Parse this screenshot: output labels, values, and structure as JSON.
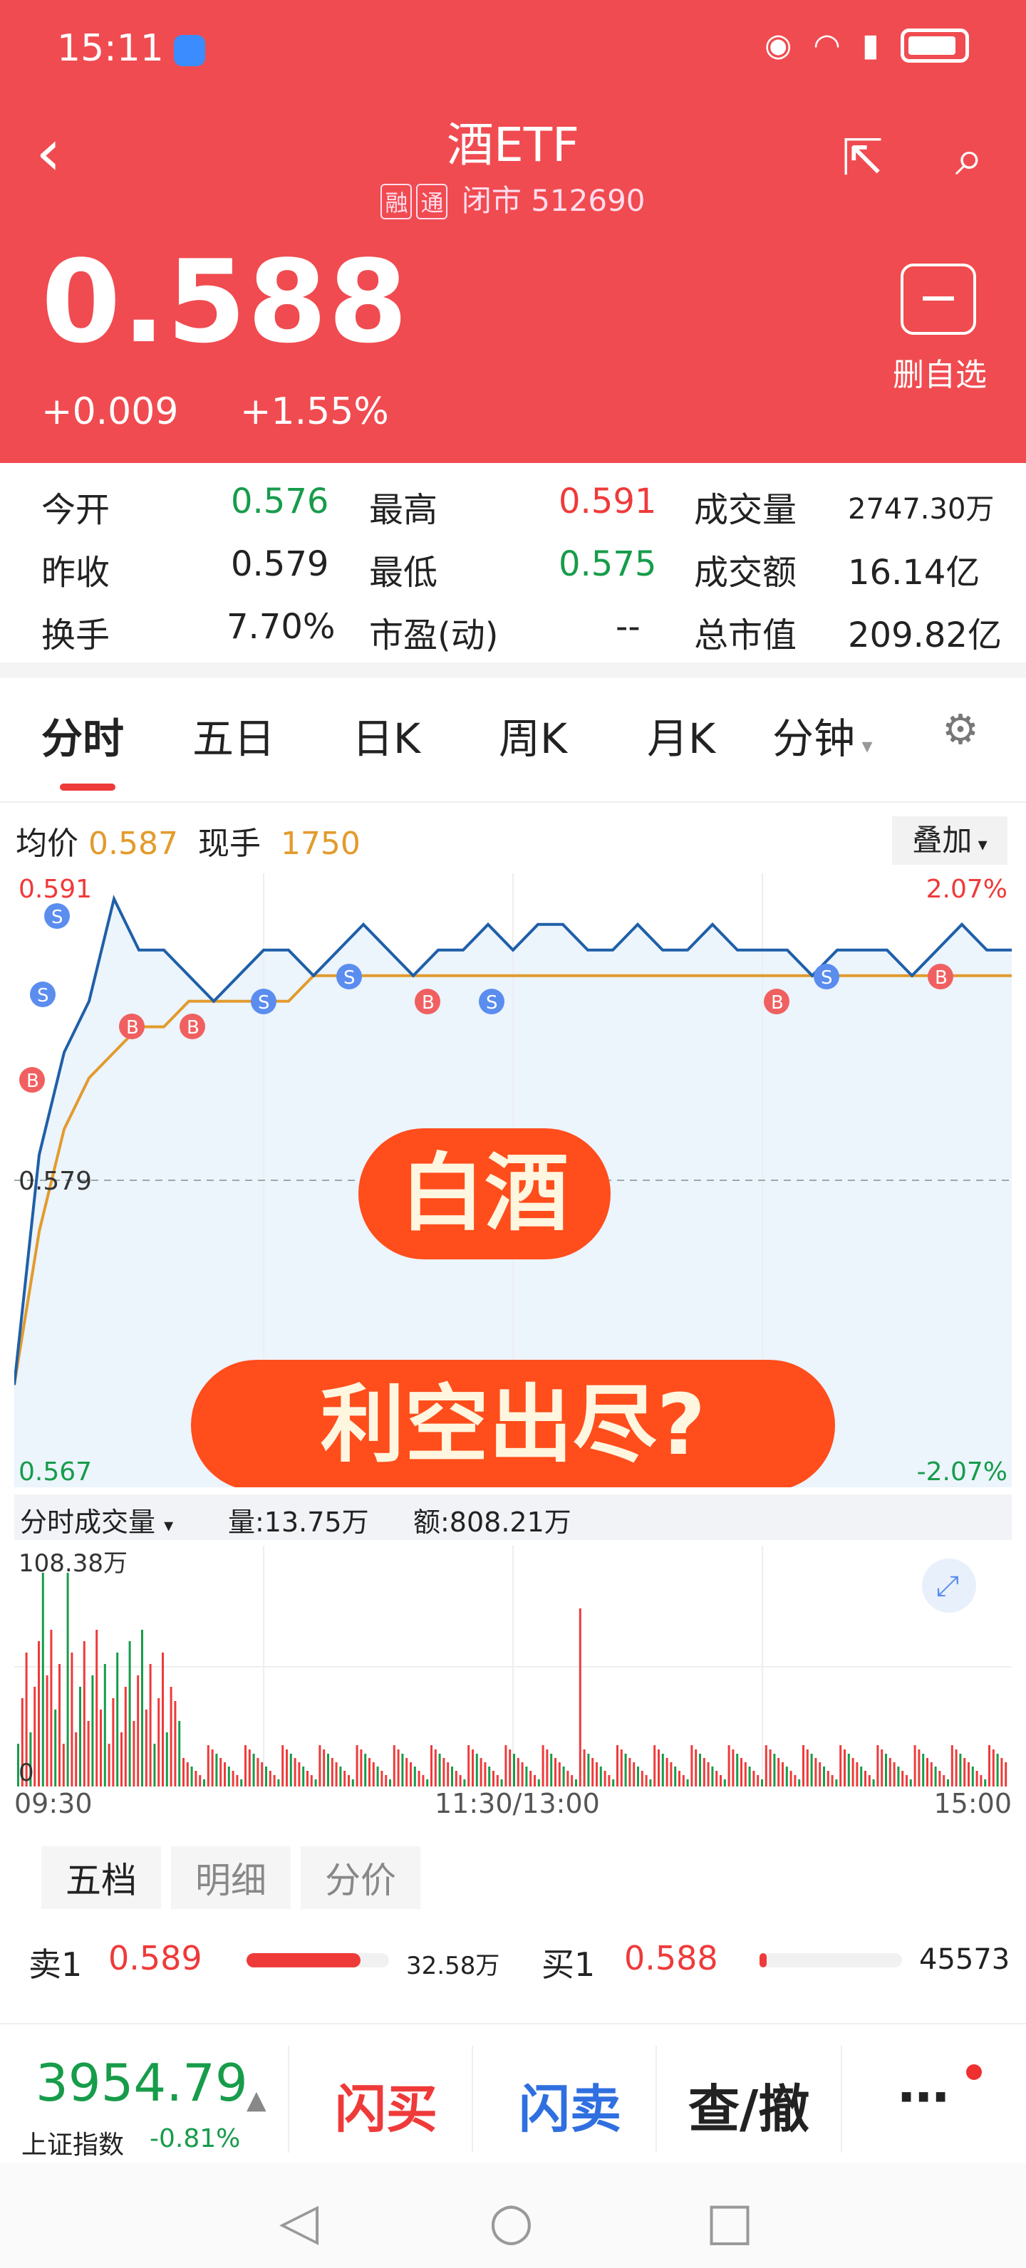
{
  "status_bar": {
    "time": "15:11"
  },
  "header": {
    "title": "酒ETF",
    "tag_rong": "融",
    "tag_tong": "通",
    "subtitle": "闭市 512690",
    "price": "0.588",
    "change": "+0.009",
    "change_pct": "+1.55%",
    "delete_label": "删自选"
  },
  "stats": [
    [
      {
        "label": "今开",
        "value": "0.576"
      },
      {
        "label": "最高",
        "value": "0.591"
      },
      {
        "label": "成交量",
        "value": "2747.30万"
      }
    ],
    [
      {
        "label": "昨收",
        "value": "0.579"
      },
      {
        "label": "最低",
        "value": "0.575"
      },
      {
        "label": "成交额",
        "value": "16.14亿"
      }
    ],
    [
      {
        "label": "换手",
        "value": "7.70%"
      },
      {
        "label": "市盈(动)",
        "value": "--"
      },
      {
        "label": "总市值",
        "value": "209.82亿"
      }
    ]
  ],
  "tabs": [
    "分时",
    "五日",
    "日K",
    "周K",
    "月K",
    "分钟"
  ],
  "chart_info": {
    "avg_label": "均价",
    "avg_value": "0.587",
    "now_label": "现手",
    "now_value": "1750",
    "overlay": "叠加"
  },
  "chart_labels": {
    "high": "0.591",
    "mid": "0.579",
    "low": "0.567",
    "pct_high": "2.07%",
    "pct_low": "-2.07%"
  },
  "overlay_text": {
    "line1": "白酒",
    "line2": "利空出尽?"
  },
  "volume_info": {
    "label": "分时成交量",
    "vol": "量:13.75万",
    "amt": "额:808.21万",
    "max": "108.38万",
    "zero": "0"
  },
  "time_axis": {
    "start": "09:30",
    "mid": "11:30/13:00",
    "end": "15:00"
  },
  "orderbook": {
    "tabs": [
      "五档",
      "明细",
      "分价"
    ],
    "sell1": {
      "label": "卖1",
      "price": "0.589",
      "vol": "32.58万"
    },
    "buy1": {
      "label": "买1",
      "price": "0.588",
      "vol": "45573"
    }
  },
  "bottom": {
    "index_value": "3954.79",
    "index_name": "上证指数",
    "index_pct": "-0.81%",
    "btn_buy": "闪买",
    "btn_sell": "闪卖",
    "btn_query": "查/撤"
  },
  "chart_data": {
    "type": "line",
    "ylim": [
      0.567,
      0.591
    ],
    "series": [
      {
        "values": [
          0.571,
          0.58,
          0.584,
          0.586,
          0.59,
          0.588,
          0.588,
          0.587,
          0.586,
          0.587,
          0.588,
          0.588,
          0.587,
          0.588,
          0.589,
          0.588,
          0.587,
          0.588,
          0.588,
          0.589,
          0.588,
          0.589,
          0.589,
          0.588,
          0.588,
          0.589,
          0.588,
          0.588,
          0.589,
          0.588,
          0.588,
          0.588,
          0.587,
          0.588,
          0.588,
          0.588,
          0.587,
          0.588,
          0.589,
          0.588,
          0.588
        ]
      },
      {
        "values": [
          0.571,
          0.577,
          0.581,
          0.583,
          0.584,
          0.585,
          0.585,
          0.586,
          0.586,
          0.586,
          0.586,
          0.586,
          0.587,
          0.587,
          0.587,
          0.587,
          0.587,
          0.587,
          0.587,
          0.587,
          0.587,
          0.587,
          0.587,
          0.587,
          0.587,
          0.587,
          0.587,
          0.587,
          0.587,
          0.587,
          0.587,
          0.587,
          0.587,
          0.587,
          0.587,
          0.587,
          0.587,
          0.587,
          0.587,
          0.587,
          0.587
        ]
      }
    ]
  }
}
